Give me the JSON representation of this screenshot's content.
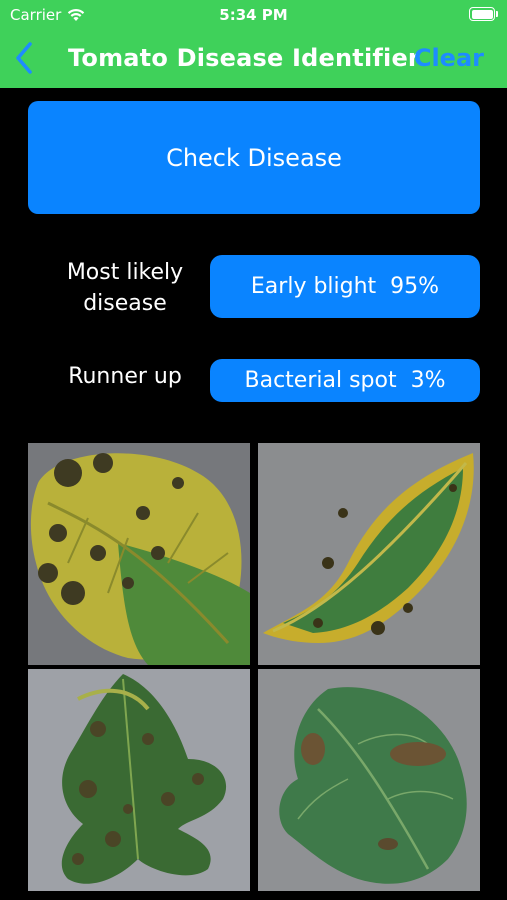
{
  "status": {
    "carrier": "Carrier",
    "time": "5:34 PM"
  },
  "nav": {
    "title": "Tomato Disease Identifier",
    "clear_label": "Clear"
  },
  "main": {
    "check_button_label": "Check Disease",
    "most_likely_label": "Most likely disease",
    "most_likely_value": "Early blight  95%",
    "runner_up_label": "Runner up",
    "runner_up_value": "Bacterial spot  3%"
  },
  "colors": {
    "header": "#3fd15a",
    "accent": "#0a84ff",
    "clear_text": "#1e8cff",
    "background": "#000000"
  },
  "icons": {
    "back": "chevron-left-icon",
    "wifi": "wifi-icon",
    "battery": "battery-icon"
  }
}
